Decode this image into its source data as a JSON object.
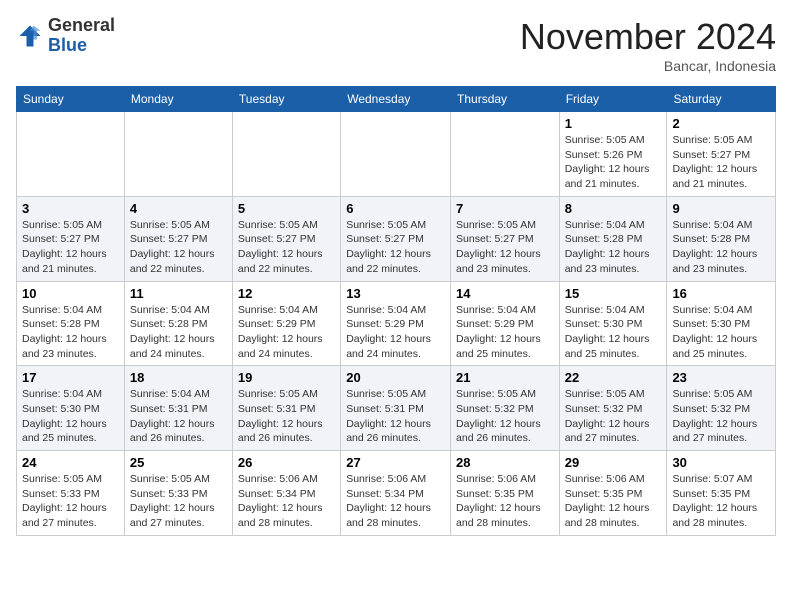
{
  "logo": {
    "general": "General",
    "blue": "Blue"
  },
  "title": "November 2024",
  "location": "Bancar, Indonesia",
  "days_of_week": [
    "Sunday",
    "Monday",
    "Tuesday",
    "Wednesday",
    "Thursday",
    "Friday",
    "Saturday"
  ],
  "weeks": [
    [
      {
        "day": "",
        "info": ""
      },
      {
        "day": "",
        "info": ""
      },
      {
        "day": "",
        "info": ""
      },
      {
        "day": "",
        "info": ""
      },
      {
        "day": "",
        "info": ""
      },
      {
        "day": "1",
        "info": "Sunrise: 5:05 AM\nSunset: 5:26 PM\nDaylight: 12 hours\nand 21 minutes."
      },
      {
        "day": "2",
        "info": "Sunrise: 5:05 AM\nSunset: 5:27 PM\nDaylight: 12 hours\nand 21 minutes."
      }
    ],
    [
      {
        "day": "3",
        "info": "Sunrise: 5:05 AM\nSunset: 5:27 PM\nDaylight: 12 hours\nand 21 minutes."
      },
      {
        "day": "4",
        "info": "Sunrise: 5:05 AM\nSunset: 5:27 PM\nDaylight: 12 hours\nand 22 minutes."
      },
      {
        "day": "5",
        "info": "Sunrise: 5:05 AM\nSunset: 5:27 PM\nDaylight: 12 hours\nand 22 minutes."
      },
      {
        "day": "6",
        "info": "Sunrise: 5:05 AM\nSunset: 5:27 PM\nDaylight: 12 hours\nand 22 minutes."
      },
      {
        "day": "7",
        "info": "Sunrise: 5:05 AM\nSunset: 5:27 PM\nDaylight: 12 hours\nand 23 minutes."
      },
      {
        "day": "8",
        "info": "Sunrise: 5:04 AM\nSunset: 5:28 PM\nDaylight: 12 hours\nand 23 minutes."
      },
      {
        "day": "9",
        "info": "Sunrise: 5:04 AM\nSunset: 5:28 PM\nDaylight: 12 hours\nand 23 minutes."
      }
    ],
    [
      {
        "day": "10",
        "info": "Sunrise: 5:04 AM\nSunset: 5:28 PM\nDaylight: 12 hours\nand 23 minutes."
      },
      {
        "day": "11",
        "info": "Sunrise: 5:04 AM\nSunset: 5:28 PM\nDaylight: 12 hours\nand 24 minutes."
      },
      {
        "day": "12",
        "info": "Sunrise: 5:04 AM\nSunset: 5:29 PM\nDaylight: 12 hours\nand 24 minutes."
      },
      {
        "day": "13",
        "info": "Sunrise: 5:04 AM\nSunset: 5:29 PM\nDaylight: 12 hours\nand 24 minutes."
      },
      {
        "day": "14",
        "info": "Sunrise: 5:04 AM\nSunset: 5:29 PM\nDaylight: 12 hours\nand 25 minutes."
      },
      {
        "day": "15",
        "info": "Sunrise: 5:04 AM\nSunset: 5:30 PM\nDaylight: 12 hours\nand 25 minutes."
      },
      {
        "day": "16",
        "info": "Sunrise: 5:04 AM\nSunset: 5:30 PM\nDaylight: 12 hours\nand 25 minutes."
      }
    ],
    [
      {
        "day": "17",
        "info": "Sunrise: 5:04 AM\nSunset: 5:30 PM\nDaylight: 12 hours\nand 25 minutes."
      },
      {
        "day": "18",
        "info": "Sunrise: 5:04 AM\nSunset: 5:31 PM\nDaylight: 12 hours\nand 26 minutes."
      },
      {
        "day": "19",
        "info": "Sunrise: 5:05 AM\nSunset: 5:31 PM\nDaylight: 12 hours\nand 26 minutes."
      },
      {
        "day": "20",
        "info": "Sunrise: 5:05 AM\nSunset: 5:31 PM\nDaylight: 12 hours\nand 26 minutes."
      },
      {
        "day": "21",
        "info": "Sunrise: 5:05 AM\nSunset: 5:32 PM\nDaylight: 12 hours\nand 26 minutes."
      },
      {
        "day": "22",
        "info": "Sunrise: 5:05 AM\nSunset: 5:32 PM\nDaylight: 12 hours\nand 27 minutes."
      },
      {
        "day": "23",
        "info": "Sunrise: 5:05 AM\nSunset: 5:32 PM\nDaylight: 12 hours\nand 27 minutes."
      }
    ],
    [
      {
        "day": "24",
        "info": "Sunrise: 5:05 AM\nSunset: 5:33 PM\nDaylight: 12 hours\nand 27 minutes."
      },
      {
        "day": "25",
        "info": "Sunrise: 5:05 AM\nSunset: 5:33 PM\nDaylight: 12 hours\nand 27 minutes."
      },
      {
        "day": "26",
        "info": "Sunrise: 5:06 AM\nSunset: 5:34 PM\nDaylight: 12 hours\nand 28 minutes."
      },
      {
        "day": "27",
        "info": "Sunrise: 5:06 AM\nSunset: 5:34 PM\nDaylight: 12 hours\nand 28 minutes."
      },
      {
        "day": "28",
        "info": "Sunrise: 5:06 AM\nSunset: 5:35 PM\nDaylight: 12 hours\nand 28 minutes."
      },
      {
        "day": "29",
        "info": "Sunrise: 5:06 AM\nSunset: 5:35 PM\nDaylight: 12 hours\nand 28 minutes."
      },
      {
        "day": "30",
        "info": "Sunrise: 5:07 AM\nSunset: 5:35 PM\nDaylight: 12 hours\nand 28 minutes."
      }
    ]
  ]
}
